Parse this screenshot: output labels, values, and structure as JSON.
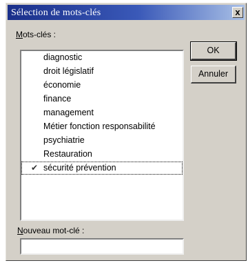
{
  "window": {
    "title": "Sélection de mots-clés",
    "close_symbol": "x"
  },
  "keywords_section": {
    "label_access_key": "M",
    "label_rest": "ots-clés :"
  },
  "keywords": [
    {
      "label": "diagnostic",
      "checked": false
    },
    {
      "label": "droit législatif",
      "checked": false
    },
    {
      "label": "économie",
      "checked": false
    },
    {
      "label": "finance",
      "checked": false
    },
    {
      "label": "management",
      "checked": false
    },
    {
      "label": "Métier fonction responsabilité",
      "checked": false
    },
    {
      "label": "psychiatrie",
      "checked": false
    },
    {
      "label": "Restauration",
      "checked": false
    },
    {
      "label": "sécurité prévention",
      "checked": true
    }
  ],
  "check_symbol": "✔",
  "buttons": {
    "ok_label": "OK",
    "cancel_label": "Annuler"
  },
  "new_keyword": {
    "label_access_key": "N",
    "label_rest": "ouveau mot-clé :",
    "value": ""
  }
}
